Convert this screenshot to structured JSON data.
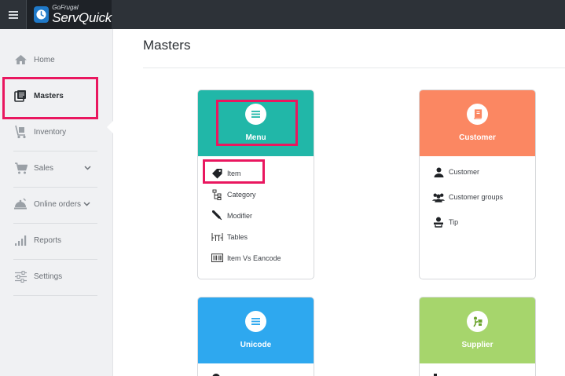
{
  "app": {
    "brand_sub": "GoFrugal",
    "brand_name": "ServQuick"
  },
  "sidebar": {
    "items": [
      {
        "label": "Home",
        "icon": "home-icon"
      },
      {
        "label": "Masters",
        "icon": "masters-icon",
        "active": true
      },
      {
        "label": "Inventory",
        "icon": "inventory-icon"
      },
      {
        "label": "Sales",
        "icon": "cart-icon",
        "has_submenu": true
      },
      {
        "label": "Online orders",
        "icon": "bell-icon",
        "has_submenu": true
      },
      {
        "label": "Reports",
        "icon": "bars-icon"
      },
      {
        "label": "Settings",
        "icon": "sliders-icon"
      }
    ]
  },
  "main": {
    "title": "Masters",
    "cards": [
      {
        "title": "Menu",
        "color": "#21b7a8",
        "icon": "list-icon",
        "items": [
          {
            "label": "Item",
            "icon": "tag-icon"
          },
          {
            "label": "Category",
            "icon": "tree-icon"
          },
          {
            "label": "Modifier",
            "icon": "pen-icon"
          },
          {
            "label": "Tables",
            "icon": "table-icon"
          },
          {
            "label": "Item Vs Eancode",
            "icon": "barcode-icon"
          }
        ]
      },
      {
        "title": "Customer",
        "color": "#fb8762",
        "icon": "book-icon",
        "items": [
          {
            "label": "Customer",
            "icon": "user-icon"
          },
          {
            "label": "Customer groups",
            "icon": "users-icon"
          },
          {
            "label": "Tip",
            "icon": "tip-icon"
          }
        ]
      },
      {
        "title": "Unicode",
        "color": "#2ea8ef",
        "icon": "list-icon",
        "items": []
      },
      {
        "title": "Supplier",
        "color": "#a6d56c",
        "icon": "supplier-icon",
        "items": []
      }
    ]
  },
  "highlight_color": "#e9175f"
}
